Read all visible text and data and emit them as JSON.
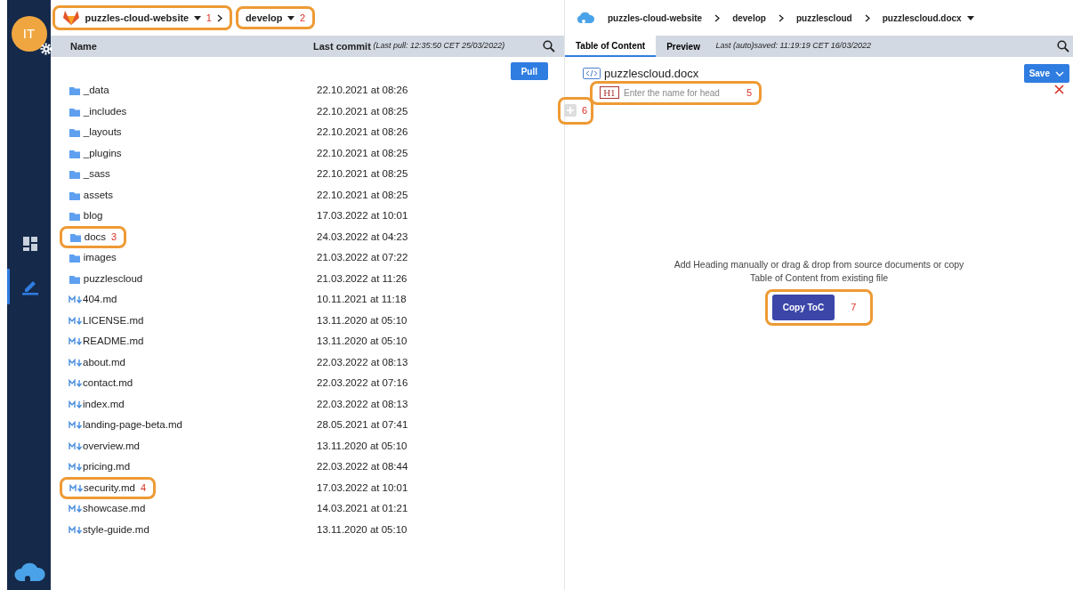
{
  "sidebar": {
    "avatar": "IT",
    "items": [
      {
        "kind": "dashboard",
        "selected": false
      },
      {
        "kind": "editor",
        "selected": true
      }
    ]
  },
  "repo": {
    "name": "puzzles-cloud-website",
    "callout": "1",
    "branch": "develop",
    "branch_callout": "2"
  },
  "file_list": {
    "columns": [
      "Name",
      "Last commit"
    ],
    "last_pull": "(Last pull: 12:35:50 CET 25/03/2022)",
    "pull_button": "Pull",
    "rows": [
      {
        "kind": "folder",
        "name": "_data",
        "date": "22.10.2021 at 08:26"
      },
      {
        "kind": "folder",
        "name": "_includes",
        "date": "22.10.2021 at 08:25"
      },
      {
        "kind": "folder",
        "name": "_layouts",
        "date": "22.10.2021 at 08:26"
      },
      {
        "kind": "folder",
        "name": "_plugins",
        "date": "22.10.2021 at 08:25"
      },
      {
        "kind": "folder",
        "name": "_sass",
        "date": "22.10.2021 at 08:25"
      },
      {
        "kind": "folder",
        "name": "assets",
        "date": "22.10.2021 at 08:25"
      },
      {
        "kind": "folder",
        "name": "blog",
        "date": "17.03.2022 at 10:01"
      },
      {
        "kind": "folder",
        "name": "docs",
        "date": "24.03.2022 at 04:23",
        "callout": "3"
      },
      {
        "kind": "folder",
        "name": "images",
        "date": "21.03.2022 at 07:22"
      },
      {
        "kind": "folder",
        "name": "puzzlescloud",
        "date": "21.03.2022 at 11:26"
      },
      {
        "kind": "markdown",
        "name": "404.md",
        "date": "10.11.2021 at 11:18"
      },
      {
        "kind": "markdown",
        "name": "LICENSE.md",
        "date": "13.11.2020 at 05:10"
      },
      {
        "kind": "markdown",
        "name": "README.md",
        "date": "13.11.2020 at 05:10"
      },
      {
        "kind": "markdown",
        "name": "about.md",
        "date": "22.03.2022 at 08:13"
      },
      {
        "kind": "markdown",
        "name": "contact.md",
        "date": "22.03.2022 at 07:16"
      },
      {
        "kind": "markdown",
        "name": "index.md",
        "date": "22.03.2022 at 08:13"
      },
      {
        "kind": "markdown",
        "name": "landing-page-beta.md",
        "date": "28.05.2021 at 07:41"
      },
      {
        "kind": "markdown",
        "name": "overview.md",
        "date": "13.11.2020 at 05:10"
      },
      {
        "kind": "markdown",
        "name": "pricing.md",
        "date": "22.03.2022 at 08:44"
      },
      {
        "kind": "markdown",
        "name": "security.md",
        "date": "17.03.2022 at 10:01",
        "callout": "4"
      },
      {
        "kind": "markdown",
        "name": "showcase.md",
        "date": "14.03.2021 at 01:21"
      },
      {
        "kind": "markdown",
        "name": "style-guide.md",
        "date": "13.11.2020 at 05:10"
      }
    ]
  },
  "editor": {
    "breadcrumbs": [
      "puzzles-cloud-website",
      "develop",
      "puzzlescloud",
      "puzzlescloud.docx"
    ],
    "tabs": [
      {
        "label": "Table of Content",
        "selected": true
      },
      {
        "label": "Preview",
        "selected": false
      }
    ],
    "last_saved": "Last (auto)saved: 11:19:19 CET 16/03/2022",
    "document": "puzzlescloud.docx",
    "save_button": "Save",
    "heading": {
      "level": "H1",
      "placeholder": "Enter the name for head",
      "callout": "5"
    },
    "add_callout": "6",
    "empty_message": "Add Heading manually or drag & drop from source documents or copy Table of Content from existing file",
    "copy_button": "Copy ToC",
    "copy_callout": "7"
  }
}
